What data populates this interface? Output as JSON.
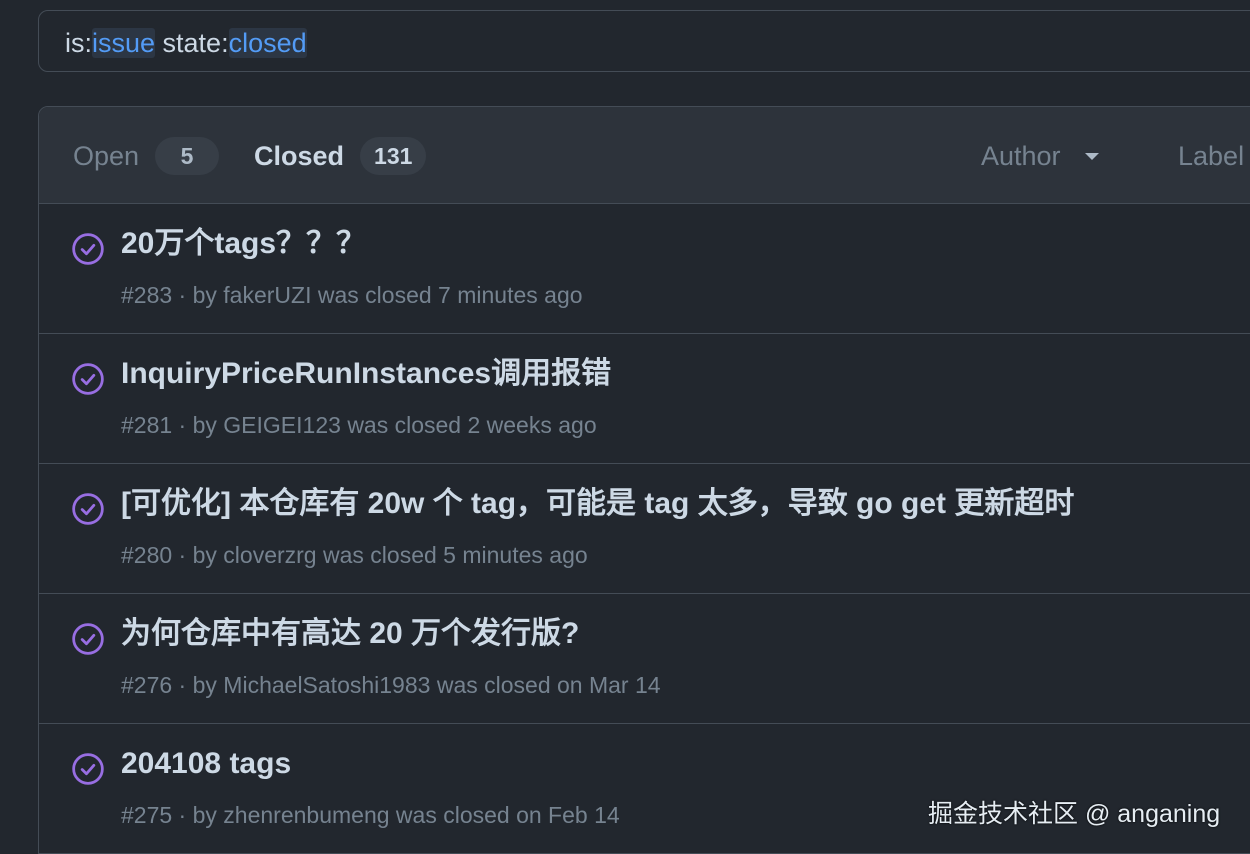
{
  "search": {
    "tokens": [
      {
        "text": "is:",
        "kind": "key"
      },
      {
        "text": "issue",
        "kind": "value"
      },
      {
        "text": " state:",
        "kind": "key"
      },
      {
        "text": "closed",
        "kind": "value"
      }
    ]
  },
  "header": {
    "open_label": "Open",
    "open_count": "5",
    "closed_label": "Closed",
    "closed_count": "131",
    "author_label": "Author",
    "label_label": "Label"
  },
  "issues": [
    {
      "title": "20万个tags？？？",
      "number": "#283",
      "author": "fakerUZI",
      "closed_text": "was closed 7 minutes ago"
    },
    {
      "title": "InquiryPriceRunInstances调用报错",
      "number": "#281",
      "author": "GEIGEI123",
      "closed_text": "was closed 2 weeks ago"
    },
    {
      "title": "[可优化] 本仓库有 20w 个 tag，可能是 tag 太多，导致 go get 更新超时",
      "number": "#280",
      "author": "cloverzrg",
      "closed_text": "was closed 5 minutes ago"
    },
    {
      "title": "为何仓库中有高达 20 万个发行版?",
      "number": "#276",
      "author": "MichaelSatoshi1983",
      "closed_text": "was closed on Mar 14"
    },
    {
      "title": "204108 tags",
      "number": "#275",
      "author": "zhenrenbumeng",
      "closed_text": "was closed on Feb 14"
    }
  ],
  "watermark": "掘金技术社区 @ anganing",
  "colors": {
    "background": "#22272e",
    "header_bg": "#2d333b",
    "border": "#444c56",
    "closed_icon": "#986ee2",
    "search_value": "#539bf5"
  },
  "icons": {
    "issue_closed": "issue-closed-icon",
    "dropdown": "caret-down-icon"
  }
}
